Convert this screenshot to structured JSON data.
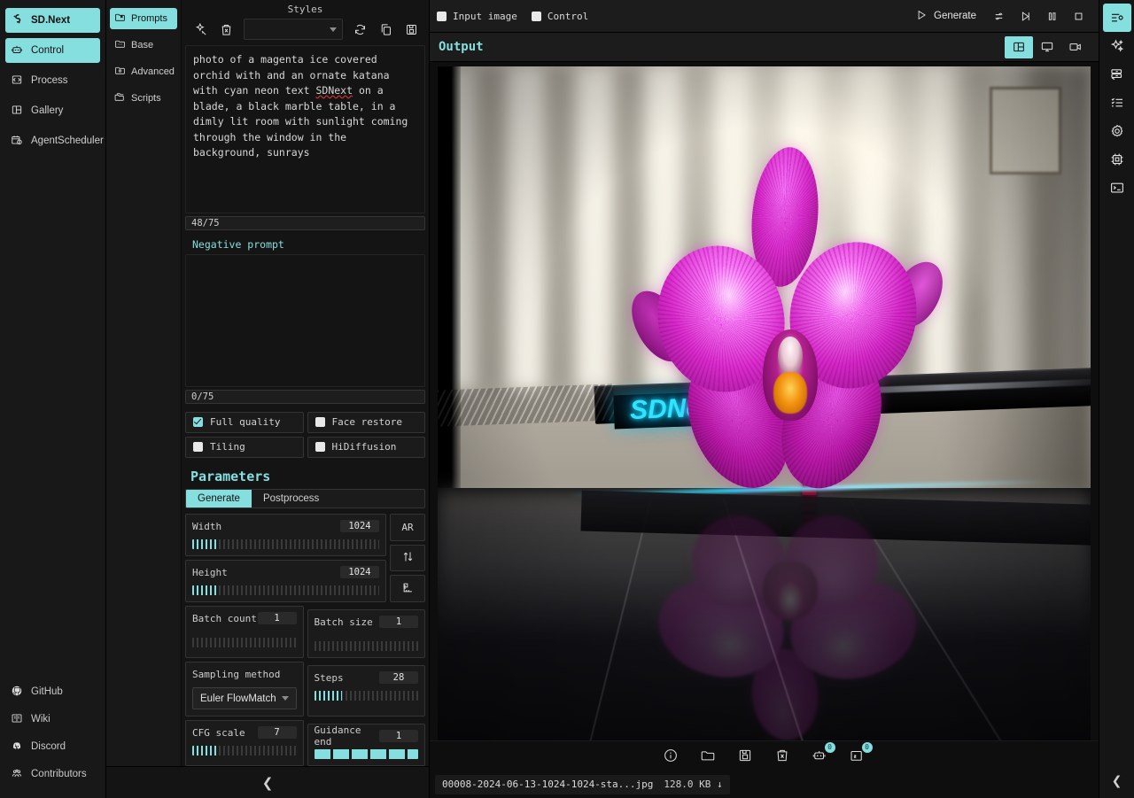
{
  "app": {
    "name": "SD.Next",
    "accent_color": "#85dfdf",
    "background_color": "#0d0d0d"
  },
  "sidebar": {
    "logo_label": "SD.Next",
    "items": [
      {
        "label": "Control",
        "icon": "robot-icon",
        "active": true
      },
      {
        "label": "Process",
        "icon": "process-icon",
        "active": false
      },
      {
        "label": "Gallery",
        "icon": "gallery-icon",
        "active": false
      },
      {
        "label": "AgentScheduler",
        "icon": "calendar-clock-icon",
        "active": false
      }
    ],
    "footer_items": [
      {
        "label": "GitHub",
        "icon": "github-icon"
      },
      {
        "label": "Wiki",
        "icon": "book-icon"
      },
      {
        "label": "Discord",
        "icon": "discord-icon"
      },
      {
        "label": "Contributors",
        "icon": "people-icon"
      }
    ]
  },
  "subtabs": {
    "items": [
      {
        "label": "Prompts",
        "icon": "bookmark-folder-icon",
        "active": true
      },
      {
        "label": "Base",
        "icon": "dots-folder-icon",
        "active": false
      },
      {
        "label": "Advanced",
        "icon": "gear-folder-icon",
        "active": false
      },
      {
        "label": "Scripts",
        "icon": "folder-stack-icon",
        "active": false
      }
    ]
  },
  "prompt_panel": {
    "styles_label": "Styles",
    "styles_selected": "",
    "toolbar": [
      {
        "name": "apply-style-icon"
      },
      {
        "name": "delete-style-icon"
      },
      {
        "name": "refresh-icon"
      },
      {
        "name": "copy-icon"
      },
      {
        "name": "save-icon"
      }
    ],
    "positive_prompt": "photo of a magenta ice covered orchid with and an ornate katana with cyan neon text SDNext on a blade, a black marble table, in a dimly lit room with sunlight coming through the window in the background, sunrays",
    "positive_prompt_pre": "photo of a magenta ice covered orchid with and an ornate katana with cyan neon text ",
    "positive_prompt_highlight": "SDNext",
    "positive_prompt_post": " on a blade, a black marble table, in a dimly lit room with sunlight coming through the window in the background, sunrays",
    "positive_counter": "48/75",
    "negative_label": "Negative prompt",
    "negative_prompt": "",
    "negative_counter": "0/75"
  },
  "checkboxes": [
    {
      "label": "Full quality",
      "checked": true
    },
    {
      "label": "Face restore",
      "checked": false
    },
    {
      "label": "Tiling",
      "checked": false
    },
    {
      "label": "HiDiffusion",
      "checked": false
    }
  ],
  "parameters": {
    "title": "Parameters",
    "tabs": [
      {
        "label": "Generate",
        "active": true
      },
      {
        "label": "Postprocess",
        "active": false
      }
    ],
    "sliders": [
      {
        "name": "Width",
        "value": "1024",
        "fill_pct": 13
      },
      {
        "name": "Height",
        "value": "1024",
        "fill_pct": 13
      },
      {
        "name": "Batch count",
        "value": "1",
        "fill_pct": 0
      },
      {
        "name": "Batch size",
        "value": "1",
        "fill_pct": 0
      },
      {
        "name": "Steps",
        "value": "28",
        "fill_pct": 27
      },
      {
        "name": "CFG scale",
        "value": "7",
        "fill_pct": 24
      },
      {
        "name": "Guidance end",
        "value": "1",
        "fill_pct": 100
      }
    ],
    "sampling_method_label": "Sampling method",
    "sampling_method_value": "Euler FlowMatch",
    "side_buttons": [
      {
        "label": "AR",
        "name": "aspect-ratio-button"
      },
      {
        "label": "",
        "name": "swap-dimensions-button"
      },
      {
        "label": "",
        "name": "resolution-preset-button"
      }
    ]
  },
  "topbar": {
    "input_image_label": "Input image",
    "input_image_checked": false,
    "control_label": "Control",
    "control_checked": false,
    "generate_label": "Generate",
    "actions": [
      {
        "name": "reprocess-icon"
      },
      {
        "name": "skip-icon"
      },
      {
        "name": "pause-icon"
      },
      {
        "name": "stop-icon"
      }
    ]
  },
  "output": {
    "title": "Output",
    "view_modes": [
      {
        "name": "gallery-view-icon",
        "active": true
      },
      {
        "name": "preview-view-icon",
        "active": false
      },
      {
        "name": "video-view-icon",
        "active": false
      }
    ],
    "image_tools": [
      {
        "name": "info-icon",
        "badge": ""
      },
      {
        "name": "folder-icon",
        "badge": ""
      },
      {
        "name": "save-icon",
        "badge": ""
      },
      {
        "name": "delete-icon",
        "badge": ""
      },
      {
        "name": "send-to-control-icon",
        "badge": "0"
      },
      {
        "name": "send-to-process-icon",
        "badge": "0"
      }
    ],
    "filename": "00008-2024-06-13-1024-1024-sta...jpg",
    "filesize": "128.0 KB ↓"
  },
  "right_rail": {
    "items": [
      {
        "name": "settings-list-icon",
        "active": true
      },
      {
        "name": "sparkle-icon",
        "active": false
      },
      {
        "name": "models-icon",
        "active": false
      },
      {
        "name": "checklist-icon",
        "active": false
      },
      {
        "name": "gear-icon",
        "active": false
      },
      {
        "name": "cpu-icon",
        "active": false
      },
      {
        "name": "terminal-icon",
        "active": false
      }
    ],
    "collapse_glyph": "❮"
  },
  "collapse_glyph": "❮",
  "artwork": {
    "description": "Generated image: a magenta orchid flower in front of an ornate katana with cyan neon SDNext text on the blade, resting on a black marble table in a dimly lit room with sunlight through window blinds",
    "neon_text": "SDNext"
  }
}
